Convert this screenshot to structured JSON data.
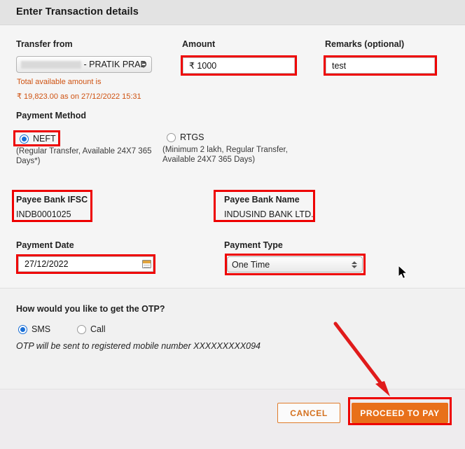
{
  "header": {
    "title": "Enter Transaction details"
  },
  "form": {
    "transfer_from": {
      "label": "Transfer from",
      "value": "- PRATIK PRAD...",
      "available_label": "Total available amount is",
      "available_value": "₹ 19,823.00 as on 27/12/2022 15:31"
    },
    "amount": {
      "label": "Amount",
      "value": "₹  1000"
    },
    "remarks": {
      "label": "Remarks (optional)",
      "value": "test"
    },
    "payment_method": {
      "label": "Payment Method",
      "options": [
        {
          "label": "NEFT",
          "note": "(Regular Transfer, Available 24X7 365 Days*)",
          "selected": true
        },
        {
          "label": "RTGS",
          "note": "(Minimum 2 lakh, Regular Transfer, Available 24X7 365 Days)",
          "selected": false
        }
      ]
    },
    "payee_bank_ifsc": {
      "label": "Payee Bank IFSC",
      "value": "INDB0001025"
    },
    "payee_bank_name": {
      "label": "Payee Bank Name",
      "value": "INDUSIND BANK LTD."
    },
    "payment_date": {
      "label": "Payment Date",
      "value": "27/12/2022",
      "icon": "calendar-icon"
    },
    "payment_type": {
      "label": "Payment Type",
      "value": "One Time"
    }
  },
  "otp": {
    "question": "How would you like to get the OTP?",
    "options": [
      {
        "label": "SMS",
        "selected": true
      },
      {
        "label": "Call",
        "selected": false
      }
    ],
    "note": "OTP will be sent to registered mobile number XXXXXXXXX094"
  },
  "footer": {
    "cancel_label": "CANCEL",
    "proceed_label": "PROCEED TO PAY"
  },
  "annotations": {
    "highlight_color": "#ee0000",
    "arrow_color": "#e01b1b",
    "accent_orange": "#e8701a"
  }
}
